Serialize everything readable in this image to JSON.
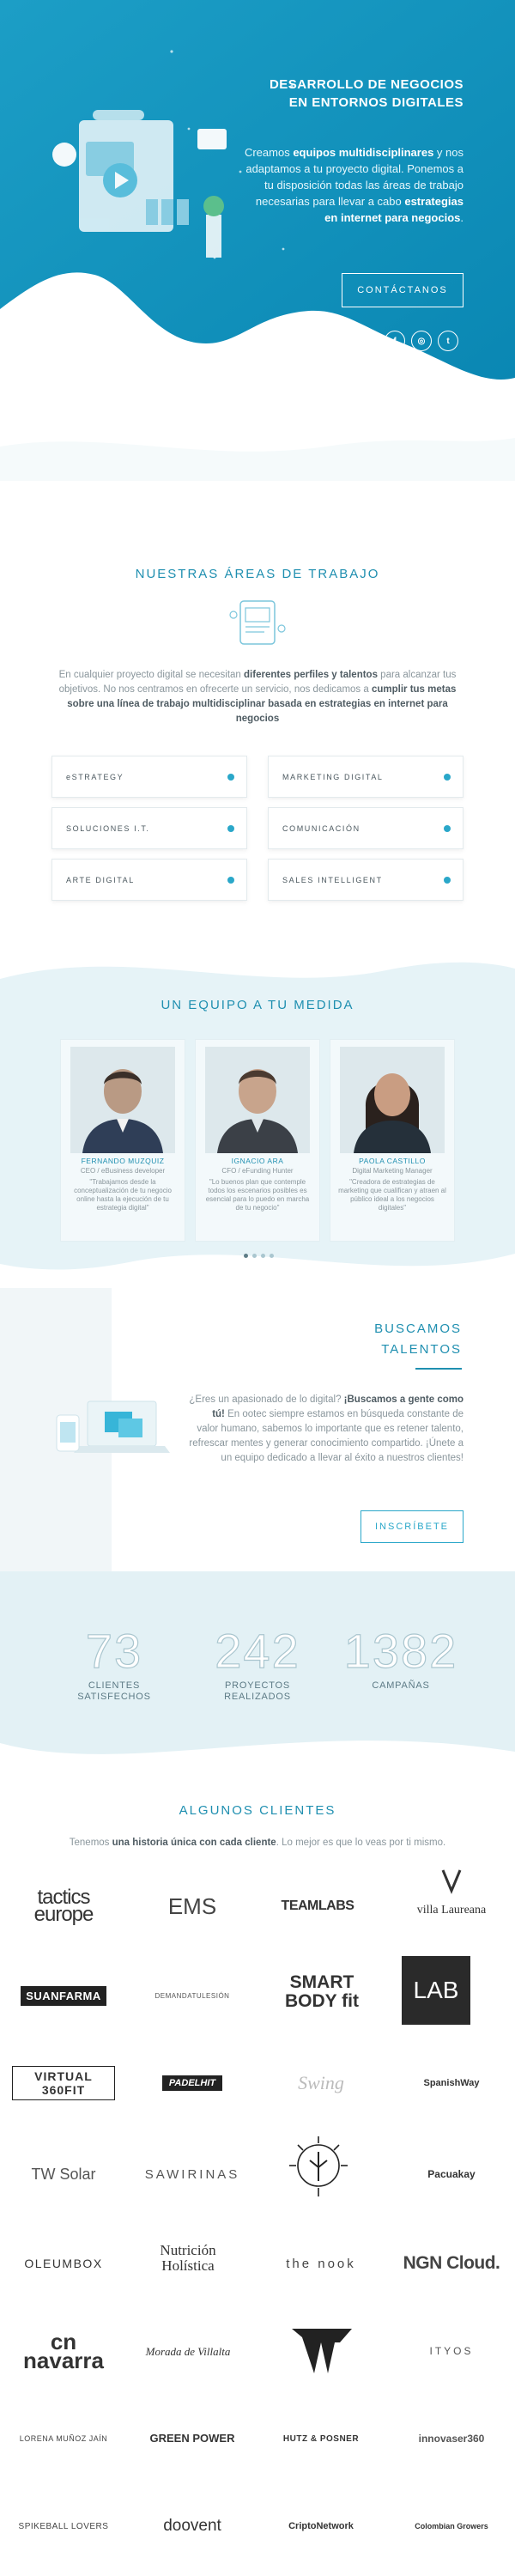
{
  "hero": {
    "title_line1": "DESARROLLO DE NEGOCIOS",
    "title_line2": "EN ENTORNOS DIGITALES",
    "desc_p1": "Creamos ",
    "desc_b1": "equipos multidisciplinares",
    "desc_p2": " y nos adaptamos a tu proyecto digital. Ponemos a tu disposición todas las áreas de trabajo necesarias para llevar a cabo ",
    "desc_b2": "estrategias en internet para negocios",
    "desc_p3": ".",
    "cta_label": "CONTÁCTANOS",
    "socials": [
      "in",
      "f",
      "◎",
      "t"
    ],
    "socials_icons": [
      "linkedin-icon",
      "facebook-icon",
      "instagram-icon",
      "twitter-icon"
    ]
  },
  "areas": {
    "title": "NUESTRAS ÁREAS DE TRABAJO",
    "desc_p1": "En cualquier proyecto digital se necesitan ",
    "desc_b1": "diferentes perfiles y talentos",
    "desc_p2": " para alcanzar tus objetivos. No nos centramos en ofrecerte un servicio, nos dedicamos a ",
    "desc_b2": "cumplir tus metas sobre una línea de trabajo multidisciplinar basada en estrategias en internet para negocios",
    "items": [
      "eSTRATEGY",
      "MARKETING DIGITAL",
      "SOLUCIONES I.T.",
      "COMUNICACIÓN",
      "ARTE DIGITAL",
      "SALES INTELLIGENT"
    ]
  },
  "team": {
    "title": "UN EQUIPO A TU MEDIDA",
    "members": [
      {
        "name": "FERNANDO MUZQUIZ",
        "role": "CEO / eBusiness developer",
        "quote": "\"Trabajamos desde la conceptualización de tu negocio online hasta la ejecución de tu estrategia digital\""
      },
      {
        "name": "IGNACIO ARA",
        "role": "CFO / eFunding Hunter",
        "quote": "\"Lo buenos plan que contemple todos los escenarios posibles es esencial para lo puedo en marcha de tu negocio\""
      },
      {
        "name": "PAOLA CASTILLO",
        "role": "Digital Marketing Manager",
        "quote": "\"Creadora de estrategias de marketing que cualifican y atraen al público ideal a los negocios digitales\""
      }
    ]
  },
  "talents": {
    "title_line1": "BUSCAMOS",
    "title_line2": "TALENTOS",
    "p1": "¿Eres un apasionado de lo digital? ",
    "b1": "¡Buscamos a gente como tú!",
    "p2": " En ootec siempre estamos en búsqueda constante de valor humano, sabemos lo importante que es retener talento, refrescar mentes y generar conocimiento compartido. ¡Únete a un equipo dedicado a llevar al éxito a nuestros clientes!",
    "cta_label": "INSCRÍBETE"
  },
  "stats": [
    {
      "number": "73",
      "label_line1": "CLIENTES",
      "label_line2": "SATISFECHOS"
    },
    {
      "number": "242",
      "label_line1": "PROYECTOS",
      "label_line2": "REALIZADOS"
    },
    {
      "number": "1382",
      "label_line1": "CAMPAÑAS",
      "label_line2": ""
    }
  ],
  "clients": {
    "title": "ALGUNOS CLIENTES",
    "desc_p1": "Tenemos ",
    "desc_b1": "una historia única con cada cliente",
    "desc_p2": ". Lo mejor es que lo veas por ti mismo.",
    "logos": [
      "tactics europe",
      "EMS",
      "TEAMLABS",
      "villa Laureana",
      "SUANFARMA",
      "DEMANDATULESIÓN",
      "SMART BODY fit",
      "LAB",
      "VIRTUAL 360FIT",
      "PADELHIT",
      "Swing",
      "SpanishWay",
      "TW Solar",
      "SAWIRINAS",
      "",
      "Pacuakay",
      "OLEUMBOX",
      "Nutrición Holística",
      "the nook",
      "NGN Cloud.",
      "cn navarra",
      "Morada de Villalta",
      "",
      "ITYOS",
      "LORENA MUÑOZ JAÍN",
      "GREEN POWER",
      "HUTZ & POSNER",
      "innovaser360",
      "SPIKEBALL LOVERS",
      "doovent",
      "CriptoNetwork",
      "Colombian Growers"
    ]
  }
}
